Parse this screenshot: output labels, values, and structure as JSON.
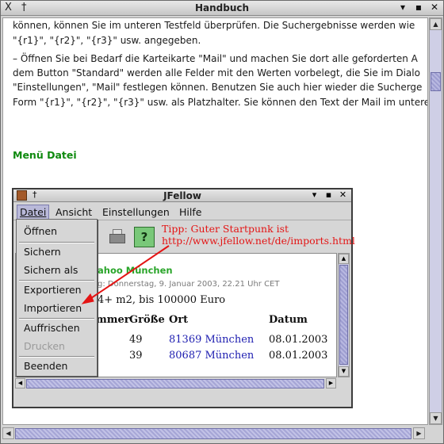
{
  "window": {
    "title": "Handbuch",
    "x_icon": "X",
    "pin_icon": "†",
    "buttons": [
      "▾",
      "▪",
      "✕"
    ]
  },
  "doc": {
    "lines": [
      "können, können Sie im unteren Testfeld überprüfen. Die Suchergebnisse werden wie",
      "\"{r1}\", \"{r2}\", \"{r3}\" usw. angegeben.",
      "– Öffnen Sie bei Bedarf die Karteikarte \"Mail\" und machen Sie dort alle geforderten A",
      "dem Button \"Standard\" werden alle Felder mit den Werten vorbelegt, die Sie im Dialo",
      "\"Einstellungen\", \"Mail\" festlegen können. Benutzen Sie auch hier wieder die Sucherge",
      "Form \"{r1}\", \"{r2}\", \"{r3}\" usw. als Platzhalter. Sie können den Text der Mail im untere"
    ],
    "heading": "Menü Datei"
  },
  "jfellow": {
    "title": "JFellow",
    "menus": [
      "Datei",
      "Ansicht",
      "Einstellungen",
      "Hilfe"
    ],
    "dropdown": {
      "items": [
        {
          "label": "Öffnen",
          "enabled": true
        },
        {
          "label": "Sichern",
          "enabled": true
        },
        {
          "label": "Sichern als",
          "enabled": true
        },
        {
          "label": "Exportieren",
          "enabled": true
        },
        {
          "label": "Importieren",
          "enabled": true
        },
        {
          "label": "Auffrischen",
          "enabled": true
        },
        {
          "label": "Drucken",
          "enabled": false
        },
        {
          "label": "Beenden",
          "enabled": true
        }
      ]
    },
    "tip_line1": "Tipp: Guter Startpunk ist",
    "tip_line2": "http://www.jfellow.net/de/imports.html",
    "help_label": "?",
    "content": {
      "source": "ahoo München",
      "date": "g: Donnerstag, 9. Januar 2003, 22.21 Uhr CET",
      "query": "4+ m2, bis 100000 Euro",
      "headers": [
        "mmer",
        "Größe",
        "Ort",
        "Datum"
      ],
      "rows": [
        {
          "size": "49",
          "ort": "81369 München",
          "datum": "08.01.2003"
        },
        {
          "size": "39",
          "ort": "80687 München",
          "datum": "08.01.2003"
        }
      ]
    }
  },
  "colors": {
    "heading_green": "#0f8a0f",
    "tip_red": "#e41414",
    "link_blue": "#1d1db0",
    "selection": "#b9b9d9"
  }
}
